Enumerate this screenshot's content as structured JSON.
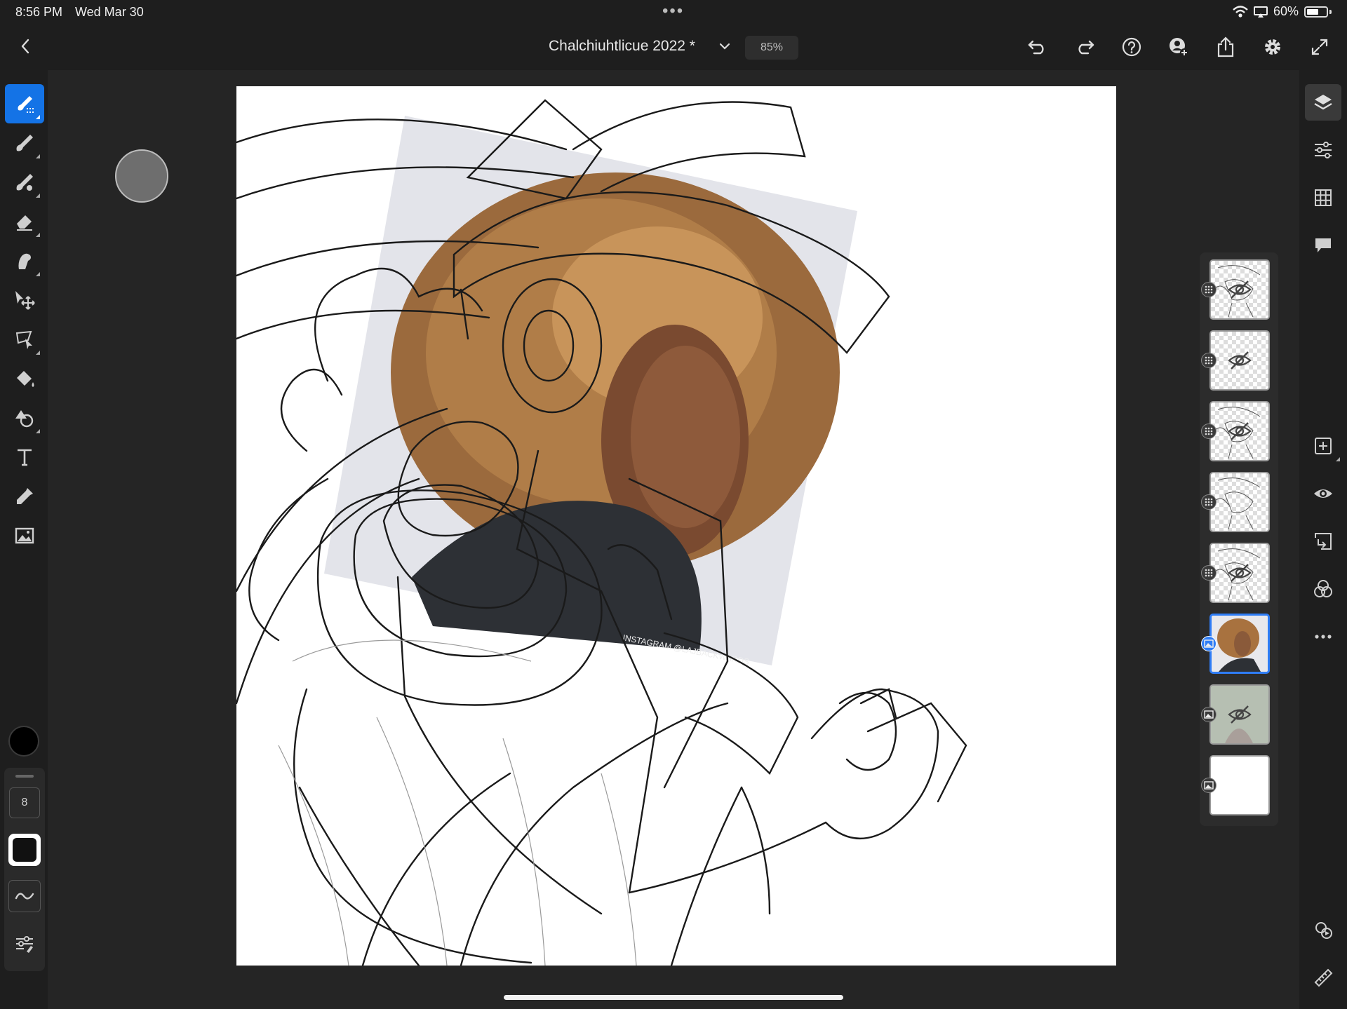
{
  "status_bar": {
    "time": "8:56 PM",
    "date": "Wed Mar 30",
    "battery": "60%",
    "battery_level": 0.6,
    "icons": [
      "wifi-icon",
      "screen-mirror-icon",
      "battery-icon"
    ]
  },
  "header": {
    "title": "Chalchiuhtlicue 2022 *",
    "zoom": "85%",
    "icons": [
      "undo-icon",
      "redo-icon",
      "help-icon",
      "invite-user-icon",
      "share-icon",
      "settings-gear-icon",
      "fullscreen-icon"
    ]
  },
  "left_toolbar": {
    "tools": [
      "selection-brush-icon",
      "paint-brush-icon",
      "blend-brush-icon",
      "eraser-icon",
      "smudge-icon",
      "move-transform-icon",
      "lasso-icon",
      "fill-bucket-icon",
      "shape-icon",
      "text-icon",
      "eyedropper-icon",
      "image-place-icon"
    ],
    "active_tool": "selection-brush-icon",
    "color": "#000000",
    "brush_size": "8"
  },
  "right_toolbar": {
    "top_tools": [
      "layers-icon",
      "adjustments-icon",
      "grid-icon",
      "comments-icon"
    ],
    "layer_tools": [
      "add-layer-icon",
      "visibility-icon",
      "merge-down-icon",
      "blend-mode-icon",
      "more-icon"
    ],
    "bottom_tools": [
      "livestream-icon",
      "ruler-icon"
    ]
  },
  "layers": [
    {
      "type": "sketch",
      "hidden": true
    },
    {
      "type": "transparent",
      "hidden": true
    },
    {
      "type": "sketch",
      "hidden": true
    },
    {
      "type": "sketch",
      "hidden": false
    },
    {
      "type": "sketch",
      "hidden": true
    },
    {
      "type": "photo",
      "hidden": false,
      "selected": true
    },
    {
      "type": "photo-faded",
      "hidden": true
    },
    {
      "type": "white",
      "hidden": false
    }
  ],
  "canvas": {
    "watermark": "INSTAGRAM @LAJBACKWARDS"
  },
  "colors": {
    "accent": "#1473e6",
    "selected_layer": "#2f7df6",
    "panel_bg": "#1e1e1e",
    "workspace_bg": "#252525"
  }
}
